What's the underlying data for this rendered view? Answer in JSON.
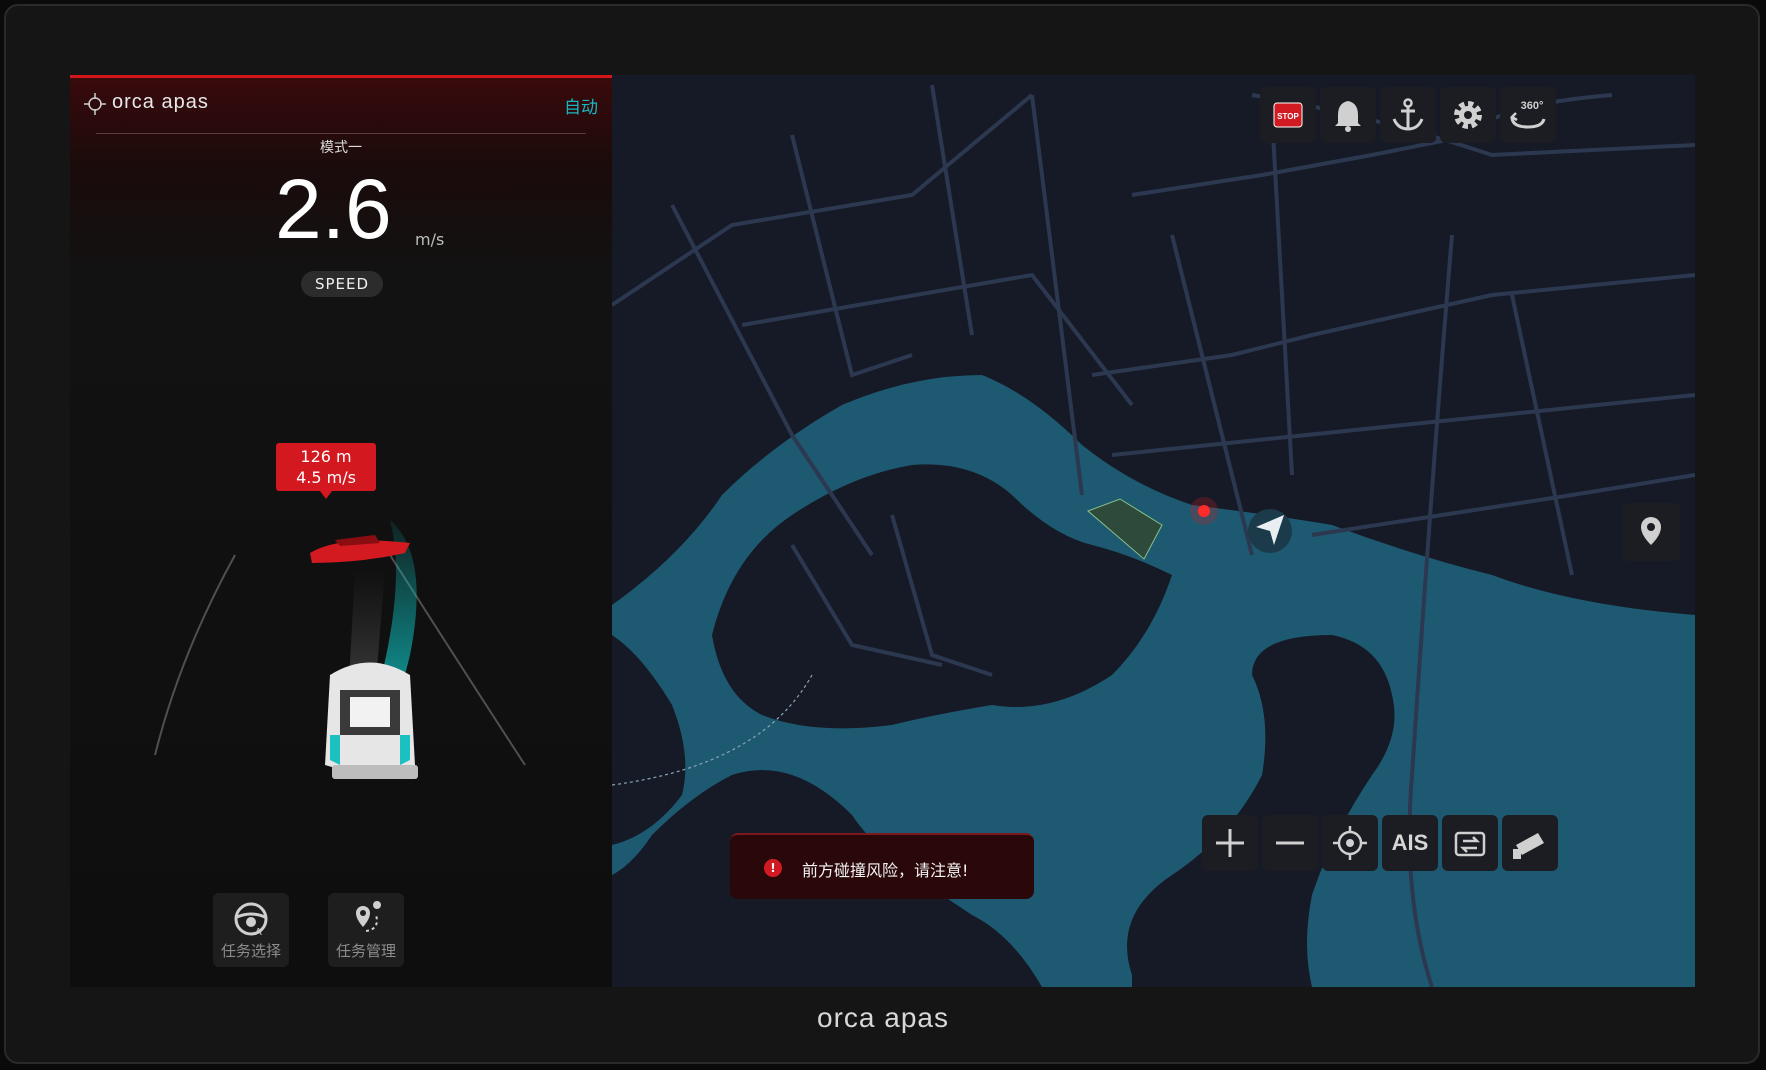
{
  "brand": {
    "name": "orca apas"
  },
  "left_panel": {
    "mode_label": "自动",
    "mode_name": "模式一",
    "speed": {
      "value": "2.6",
      "unit": "m/s",
      "label": "SPEED"
    },
    "target": {
      "distance": "126 m",
      "speed": "4.5 m/s"
    },
    "buttons": [
      {
        "label": "任务选择",
        "icon": "steering-wheel-icon"
      },
      {
        "label": "任务管理",
        "icon": "route-pin-icon"
      }
    ]
  },
  "map": {
    "top_tools": [
      {
        "name": "stop-button",
        "icon": "stop-icon",
        "text": "STOP"
      },
      {
        "name": "alarm-button",
        "icon": "bell-icon"
      },
      {
        "name": "anchor-button",
        "icon": "anchor-icon"
      },
      {
        "name": "settings-button",
        "icon": "gear-icon"
      },
      {
        "name": "view-360-button",
        "icon": "rotate-360-icon",
        "text": "360°"
      }
    ],
    "bottom_tools": [
      {
        "name": "zoom-in-button",
        "icon": "plus-icon"
      },
      {
        "name": "zoom-out-button",
        "icon": "minus-icon"
      },
      {
        "name": "center-button",
        "icon": "crosshair-icon"
      },
      {
        "name": "ais-button",
        "text": "AIS"
      },
      {
        "name": "switch-view-button",
        "icon": "swap-icon"
      },
      {
        "name": "camera-button",
        "icon": "camera-icon"
      }
    ],
    "alert_text": "前方碰撞风险，请注意!",
    "colors": {
      "water": "#1d5a72",
      "land": "#151a26",
      "road": "#2c3850",
      "alert": "#d21a22",
      "accent": "#19b7c2"
    }
  }
}
